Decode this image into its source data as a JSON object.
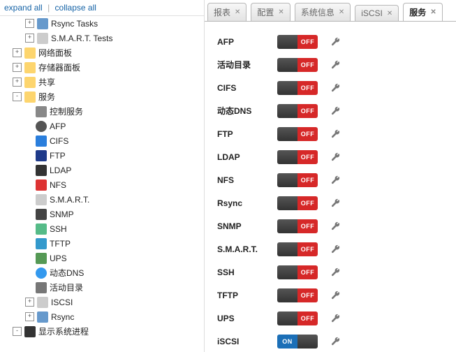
{
  "toolbar": {
    "expand_all": "expand all",
    "collapse_all": "collapse all"
  },
  "tree": [
    {
      "indent": 1,
      "expander": "+",
      "icon": "rsync",
      "label": "Rsync Tasks"
    },
    {
      "indent": 1,
      "expander": "+",
      "icon": "smart",
      "label": "S.M.A.R.T. Tests"
    },
    {
      "indent": 0,
      "expander": "+",
      "icon": "folder",
      "label": "网络面板"
    },
    {
      "indent": 0,
      "expander": "+",
      "icon": "folder",
      "label": "存储器面板"
    },
    {
      "indent": 0,
      "expander": "+",
      "icon": "folder",
      "label": "共享"
    },
    {
      "indent": 0,
      "expander": "-",
      "icon": "folder",
      "label": "服务"
    },
    {
      "indent": 1,
      "expander": "",
      "icon": "gear",
      "label": "控制服务"
    },
    {
      "indent": 1,
      "expander": "",
      "icon": "apple",
      "label": "AFP"
    },
    {
      "indent": 1,
      "expander": "",
      "icon": "win",
      "label": "CIFS"
    },
    {
      "indent": 1,
      "expander": "",
      "icon": "ftp",
      "label": "FTP"
    },
    {
      "indent": 1,
      "expander": "",
      "icon": "ldap",
      "label": "LDAP"
    },
    {
      "indent": 1,
      "expander": "",
      "icon": "nfs",
      "label": "NFS"
    },
    {
      "indent": 1,
      "expander": "",
      "icon": "smart",
      "label": "S.M.A.R.T."
    },
    {
      "indent": 1,
      "expander": "",
      "icon": "snmp",
      "label": "SNMP"
    },
    {
      "indent": 1,
      "expander": "",
      "icon": "ssh",
      "label": "SSH"
    },
    {
      "indent": 1,
      "expander": "",
      "icon": "tftp",
      "label": "TFTP"
    },
    {
      "indent": 1,
      "expander": "",
      "icon": "ups",
      "label": "UPS"
    },
    {
      "indent": 1,
      "expander": "",
      "icon": "dns",
      "label": "动态DNS"
    },
    {
      "indent": 1,
      "expander": "",
      "icon": "ad",
      "label": "活动目录"
    },
    {
      "indent": 1,
      "expander": "+",
      "icon": "iscsi",
      "label": "ISCSI"
    },
    {
      "indent": 1,
      "expander": "+",
      "icon": "rsync",
      "label": "Rsync"
    },
    {
      "indent": 0,
      "expander": "-",
      "icon": "proc",
      "label": "显示系统进程"
    }
  ],
  "tabs": [
    {
      "label": "报表",
      "active": false
    },
    {
      "label": "配置",
      "active": false
    },
    {
      "label": "系统信息",
      "active": false
    },
    {
      "label": "iSCSI",
      "active": false
    },
    {
      "label": "服务",
      "active": true
    }
  ],
  "services": [
    {
      "name": "AFP",
      "state": "OFF"
    },
    {
      "name": "活动目录",
      "state": "OFF"
    },
    {
      "name": "CIFS",
      "state": "OFF"
    },
    {
      "name": "动态DNS",
      "state": "OFF"
    },
    {
      "name": "FTP",
      "state": "OFF"
    },
    {
      "name": "LDAP",
      "state": "OFF"
    },
    {
      "name": "NFS",
      "state": "OFF"
    },
    {
      "name": "Rsync",
      "state": "OFF"
    },
    {
      "name": "SNMP",
      "state": "OFF"
    },
    {
      "name": "S.M.A.R.T.",
      "state": "OFF"
    },
    {
      "name": "SSH",
      "state": "OFF"
    },
    {
      "name": "TFTP",
      "state": "OFF"
    },
    {
      "name": "UPS",
      "state": "OFF"
    },
    {
      "name": "iSCSI",
      "state": "ON"
    }
  ]
}
